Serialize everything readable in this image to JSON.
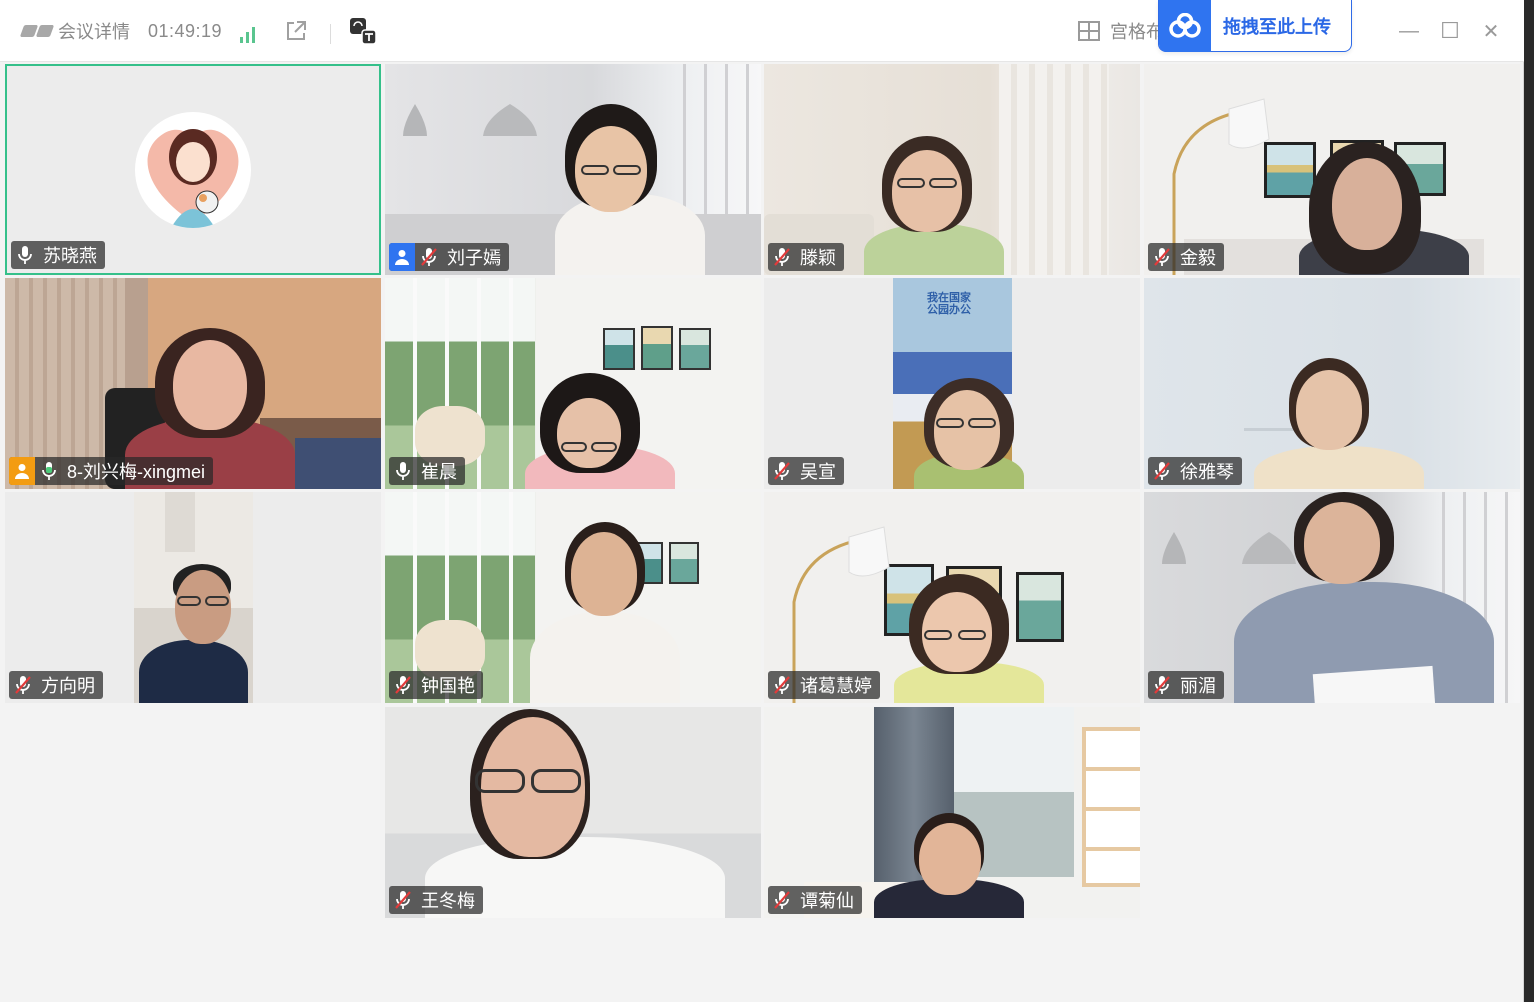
{
  "titlebar": {
    "meeting_details": "会议详情",
    "timer": "01:49:19",
    "grid_layout_label": "宫格布",
    "upload_label": "拖拽至此上传",
    "minimize": "—",
    "maximize": "☐",
    "close": "✕"
  },
  "participants": [
    {
      "name": "苏晓燕",
      "host": "",
      "mic": "on"
    },
    {
      "name": "刘子嫣",
      "host": "blue",
      "mic": "muted"
    },
    {
      "name": "滕颖",
      "host": "",
      "mic": "muted"
    },
    {
      "name": "金毅",
      "host": "",
      "mic": "muted"
    },
    {
      "name": "8-刘兴梅-xingmei",
      "host": "orange",
      "mic": "speaking"
    },
    {
      "name": "崔晨",
      "host": "",
      "mic": "on"
    },
    {
      "name": "吴宣",
      "host": "",
      "mic": "muted"
    },
    {
      "name": "徐雅琴",
      "host": "",
      "mic": "muted"
    },
    {
      "name": "方向明",
      "host": "",
      "mic": "muted"
    },
    {
      "name": "钟国艳",
      "host": "",
      "mic": "muted"
    },
    {
      "name": "诸葛慧婷",
      "host": "",
      "mic": "muted"
    },
    {
      "name": "丽湄",
      "host": "",
      "mic": "muted"
    },
    {
      "name": "王冬梅",
      "host": "",
      "mic": "muted"
    },
    {
      "name": "谭菊仙",
      "host": "",
      "mic": "muted"
    }
  ],
  "colors": {
    "active_speaker_border": "#35c08a",
    "signal": "#5ac58f",
    "upload_blue": "#2f74f0"
  },
  "background_image_text": {
    "poster_title": "我在国家",
    "poster_subtitle": "公园办公"
  }
}
